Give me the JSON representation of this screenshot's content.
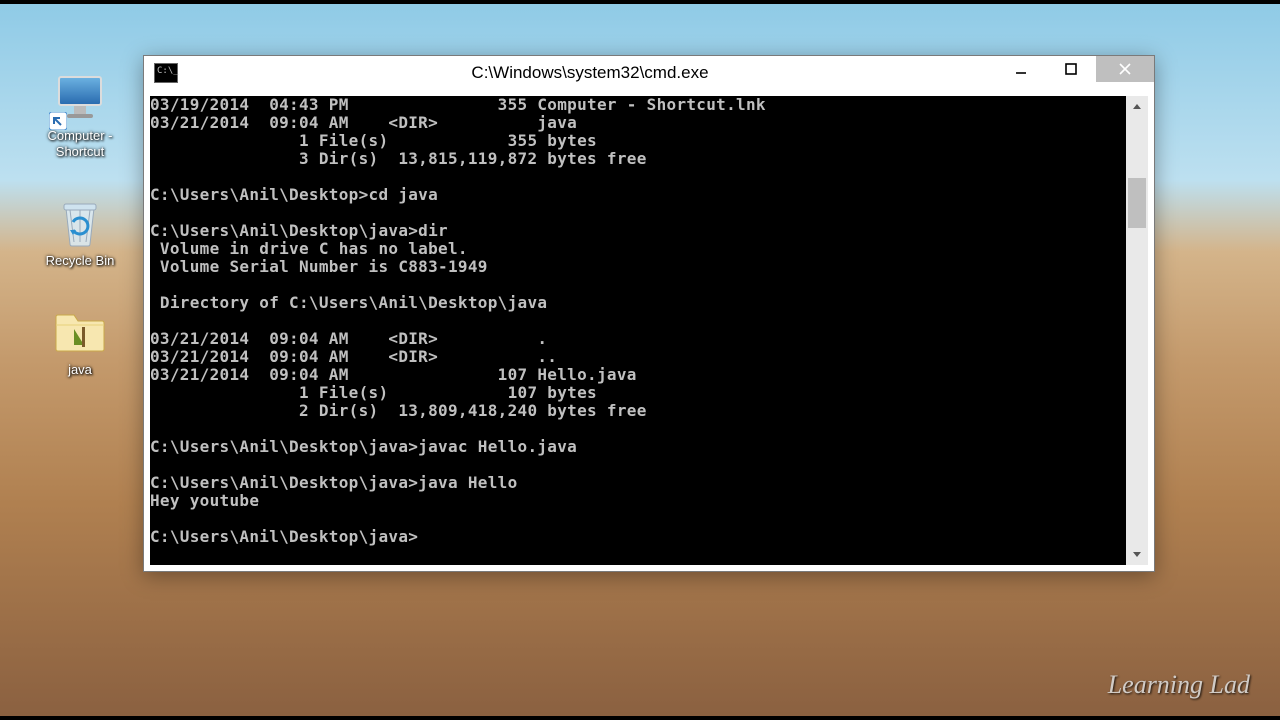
{
  "desktop": {
    "icons": [
      {
        "id": "computer-shortcut",
        "label": "Computer - Shortcut"
      },
      {
        "id": "recycle-bin",
        "label": "Recycle Bin"
      },
      {
        "id": "java-folder",
        "label": "java"
      }
    ]
  },
  "watermark": "Learning Lad",
  "window": {
    "title": "C:\\Windows\\system32\\cmd.exe",
    "controls": {
      "minimize": "Minimize",
      "maximize": "Maximize",
      "close": "Close"
    }
  },
  "console": {
    "lines": [
      "03/19/2014  04:43 PM               355 Computer - Shortcut.lnk",
      "03/21/2014  09:04 AM    <DIR>          java",
      "               1 File(s)            355 bytes",
      "               3 Dir(s)  13,815,119,872 bytes free",
      "",
      "C:\\Users\\Anil\\Desktop>cd java",
      "",
      "C:\\Users\\Anil\\Desktop\\java>dir",
      " Volume in drive C has no label.",
      " Volume Serial Number is C883-1949",
      "",
      " Directory of C:\\Users\\Anil\\Desktop\\java",
      "",
      "03/21/2014  09:04 AM    <DIR>          .",
      "03/21/2014  09:04 AM    <DIR>          ..",
      "03/21/2014  09:04 AM               107 Hello.java",
      "               1 File(s)            107 bytes",
      "               2 Dir(s)  13,809,418,240 bytes free",
      "",
      "C:\\Users\\Anil\\Desktop\\java>javac Hello.java",
      "",
      "C:\\Users\\Anil\\Desktop\\java>java Hello",
      "Hey youtube",
      "",
      "C:\\Users\\Anil\\Desktop\\java>"
    ]
  }
}
